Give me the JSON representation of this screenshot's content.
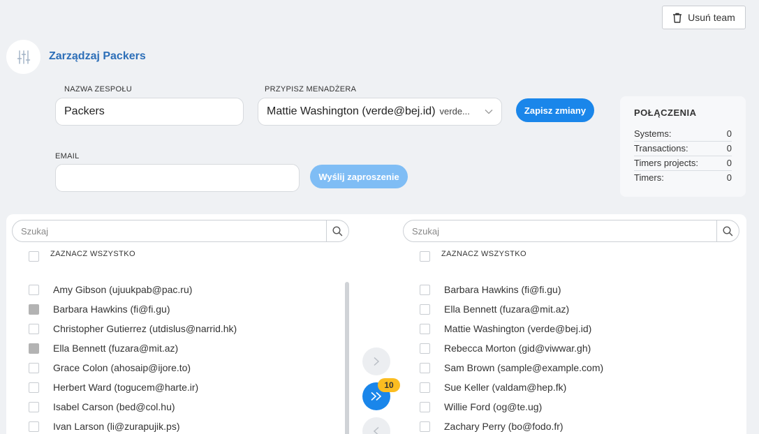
{
  "header": {
    "delete_label": "Usuń team",
    "title": "Zarządzaj Packers"
  },
  "form": {
    "team_name_label": "NAZWA ZESPOŁU",
    "team_name_value": "Packers",
    "manager_label": "PRZYPISZ MENADŻERA",
    "manager_value": "Mattie Washington (verde@bej.id)",
    "manager_value_sub": "verde...",
    "save_label": "Zapisz zmiany",
    "email_label": "EMAIL",
    "email_value": "",
    "invite_label": "Wyślij zaproszenie"
  },
  "connections": {
    "title": "POŁĄCZENIA",
    "rows": [
      {
        "label": "Systems:",
        "value": "0"
      },
      {
        "label": "Transactions:",
        "value": "0"
      },
      {
        "label": "Timers projects:",
        "value": "0"
      },
      {
        "label": "Timers:",
        "value": "0"
      }
    ]
  },
  "left_list": {
    "search_placeholder": "Szukaj",
    "select_all_label": "ZAZNACZ WSZYSTKO",
    "items": [
      {
        "name": "Amy Gibson (ujuukpab@pac.ru)",
        "checked": false
      },
      {
        "name": "Barbara Hawkins (fi@fi.gu)",
        "checked": true
      },
      {
        "name": "Christopher Gutierrez (utdislus@narrid.hk)",
        "checked": false
      },
      {
        "name": "Ella Bennett (fuzara@mit.az)",
        "checked": true
      },
      {
        "name": "Grace Colon (ahosaip@ijore.to)",
        "checked": false
      },
      {
        "name": "Herbert Ward (togucem@harte.ir)",
        "checked": false
      },
      {
        "name": "Isabel Carson (bed@col.hu)",
        "checked": false
      },
      {
        "name": "Ivan Larson (li@zurapujik.ps)",
        "checked": false
      }
    ]
  },
  "right_list": {
    "search_placeholder": "Szukaj",
    "select_all_label": "ZAZNACZ WSZYSTKO",
    "items": [
      {
        "name": "Barbara Hawkins (fi@fi.gu)",
        "checked": false
      },
      {
        "name": "Ella Bennett (fuzara@mit.az)",
        "checked": false
      },
      {
        "name": "Mattie Washington (verde@bej.id)",
        "checked": false
      },
      {
        "name": "Rebecca Morton (gid@viwwar.gh)",
        "checked": false
      },
      {
        "name": "Sam Brown (sample@example.com)",
        "checked": false
      },
      {
        "name": "Sue Keller (valdam@hep.fk)",
        "checked": false
      },
      {
        "name": "Willie Ford (og@te.ug)",
        "checked": false
      },
      {
        "name": "Zachary Perry (bo@fodo.fr)",
        "checked": false
      }
    ]
  },
  "transfer": {
    "move_all_count": "10",
    "icons": [
      "chevron-right-icon",
      "double-chevron-right-icon",
      "chevron-left-icon"
    ]
  },
  "colors": {
    "accent": "#1a86ea",
    "title": "#2d6fb8",
    "badge": "#fbbd21",
    "background": "#eff1f4"
  }
}
